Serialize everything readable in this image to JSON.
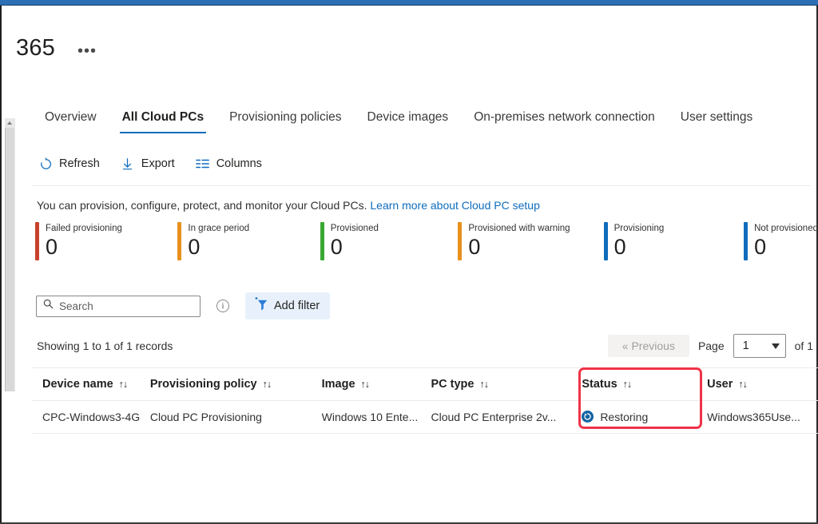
{
  "header": {
    "title": "365",
    "ellipsis": "•••"
  },
  "tabs": [
    {
      "label": "Overview",
      "active": false
    },
    {
      "label": "All Cloud PCs",
      "active": true
    },
    {
      "label": "Provisioning policies",
      "active": false
    },
    {
      "label": "Device images",
      "active": false
    },
    {
      "label": "On-premises network connection",
      "active": false
    },
    {
      "label": "User settings",
      "active": false
    }
  ],
  "commandbar": {
    "refresh": "Refresh",
    "export": "Export",
    "columns": "Columns"
  },
  "description": {
    "text": "You can provision, configure, protect, and monitor your Cloud PCs.",
    "link": "Learn more about Cloud PC setup"
  },
  "tiles": [
    {
      "label": "Failed provisioning",
      "value": "0",
      "color": "#c8412c"
    },
    {
      "label": "In grace period",
      "value": "0",
      "color": "#e8911c"
    },
    {
      "label": "Provisioned",
      "value": "0",
      "color": "#3aa835"
    },
    {
      "label": "Provisioned with warning",
      "value": "0",
      "color": "#e8911c"
    },
    {
      "label": "Provisioning",
      "value": "0",
      "color": "#0f6cbd"
    },
    {
      "label": "Not provisioned",
      "value": "0",
      "color": "#0f6cbd"
    }
  ],
  "search": {
    "placeholder": "Search",
    "value": "",
    "add_filter_label": "Add filter"
  },
  "records": {
    "showing_text": "Showing 1 to 1 of 1 records"
  },
  "pagination": {
    "previous_label": "« Previous",
    "page_label": "Page",
    "page_value": "1",
    "of_label": "of 1"
  },
  "table": {
    "sort_arrows": "↑↓",
    "columns": [
      "Device name",
      "Provisioning policy",
      "Image",
      "PC type",
      "Status",
      "User"
    ],
    "rows": [
      {
        "device_name": "CPC-Windows3-4G",
        "provisioning_policy": "Cloud PC Provisioning",
        "image": "Windows 10 Ente...",
        "pc_type": "Cloud PC Enterprise 2v...",
        "status": "Restoring",
        "user": "Windows365Use..."
      }
    ]
  },
  "annotation": {
    "color": "#ee3348"
  }
}
